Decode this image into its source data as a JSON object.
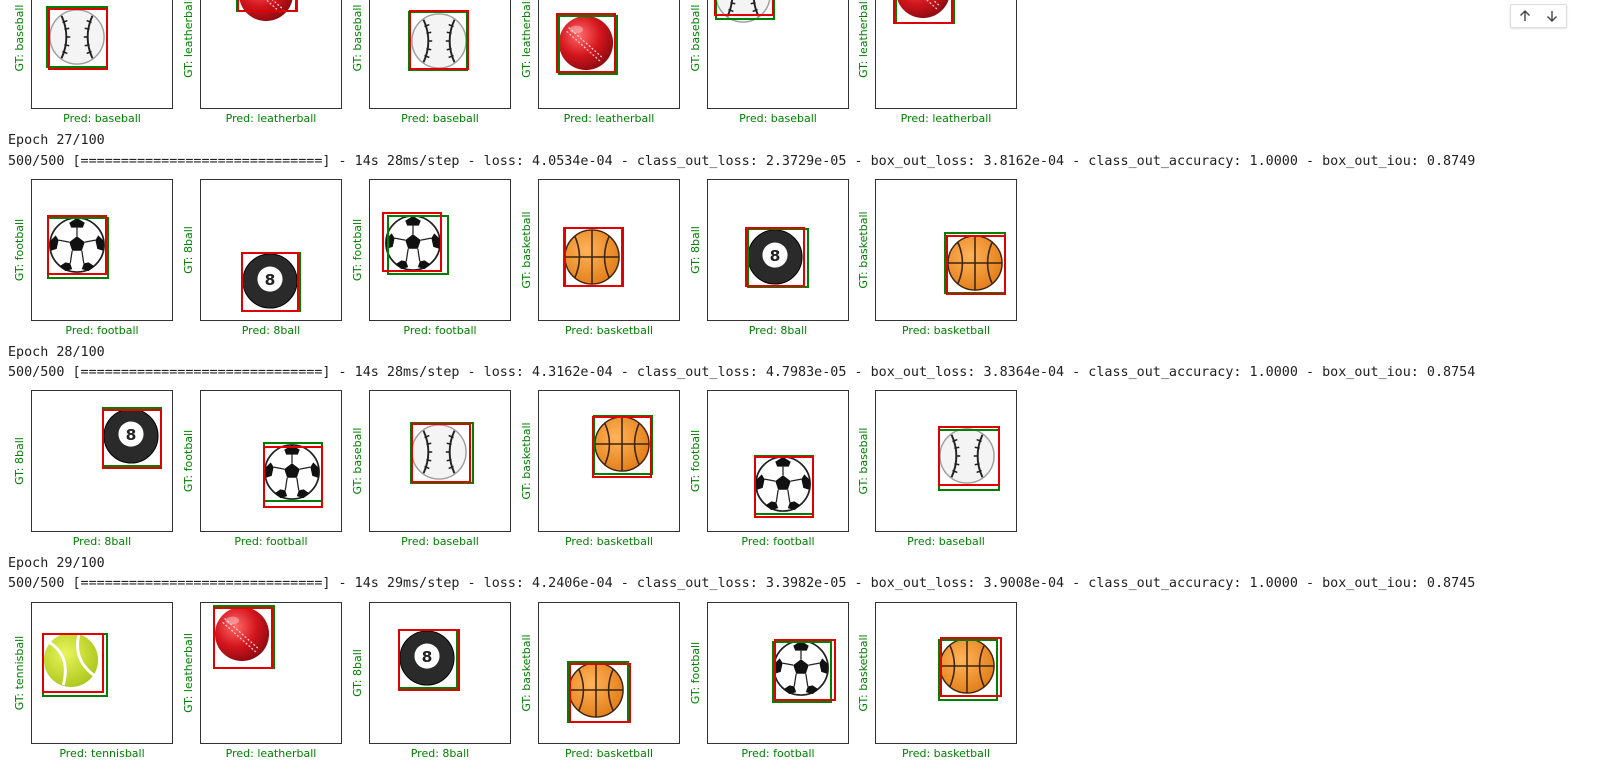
{
  "nav": {
    "up_icon": "arrow-up-icon",
    "down_icon": "arrow-down-icon"
  },
  "colors": {
    "gt_label": "#008000",
    "gt_box": "#007f00",
    "pred_box": "#e00000",
    "log_text": "#212121"
  },
  "epochs": [
    {
      "epoch_line": "",
      "progress_line": "",
      "panels": [
        {
          "gt": "GT: baseball",
          "pred": "Pred: baseball",
          "ball": "baseball"
        },
        {
          "gt": "GT: leatherball",
          "pred": "Pred: leatherball",
          "ball": "leatherball"
        },
        {
          "gt": "GT: baseball",
          "pred": "Pred: baseball",
          "ball": "baseball"
        },
        {
          "gt": "GT: leatherball",
          "pred": "Pred: leatherball",
          "ball": "leatherball"
        },
        {
          "gt": "GT: baseball",
          "pred": "Pred: baseball",
          "ball": "baseball"
        },
        {
          "gt": "GT: leatherball",
          "pred": "Pred: leatherball",
          "ball": "leatherball"
        }
      ]
    },
    {
      "epoch_line": "Epoch 27/100",
      "progress_line": "500/500 [==============================] - 14s 28ms/step - loss: 4.0534e-04 - class_out_loss: 2.3729e-05 - box_out_loss: 3.8162e-04 - class_out_accuracy: 1.0000 - box_out_iou: 0.8749",
      "panels": [
        {
          "gt": "GT: football",
          "pred": "Pred: football",
          "ball": "football"
        },
        {
          "gt": "GT: 8ball",
          "pred": "Pred: 8ball",
          "ball": "8ball"
        },
        {
          "gt": "GT: football",
          "pred": "Pred: football",
          "ball": "football"
        },
        {
          "gt": "GT: basketball",
          "pred": "Pred: basketball",
          "ball": "basketball"
        },
        {
          "gt": "GT: 8ball",
          "pred": "Pred: 8ball",
          "ball": "8ball"
        },
        {
          "gt": "GT: basketball",
          "pred": "Pred: basketball",
          "ball": "basketball"
        }
      ]
    },
    {
      "epoch_line": "Epoch 28/100",
      "progress_line": "500/500 [==============================] - 14s 28ms/step - loss: 4.3162e-04 - class_out_loss: 4.7983e-05 - box_out_loss: 3.8364e-04 - class_out_accuracy: 1.0000 - box_out_iou: 0.8754",
      "panels": [
        {
          "gt": "GT: 8ball",
          "pred": "Pred: 8ball",
          "ball": "8ball"
        },
        {
          "gt": "GT: football",
          "pred": "Pred: football",
          "ball": "football"
        },
        {
          "gt": "GT: baseball",
          "pred": "Pred: baseball",
          "ball": "baseball"
        },
        {
          "gt": "GT: basketball",
          "pred": "Pred: basketball",
          "ball": "basketball"
        },
        {
          "gt": "GT: football",
          "pred": "Pred: football",
          "ball": "football"
        },
        {
          "gt": "GT: baseball",
          "pred": "Pred: baseball",
          "ball": "baseball"
        }
      ]
    },
    {
      "epoch_line": "Epoch 29/100",
      "progress_line": "500/500 [==============================] - 14s 29ms/step - loss: 4.2406e-04 - class_out_loss: 3.3982e-05 - box_out_loss: 3.9008e-04 - class_out_accuracy: 1.0000 - box_out_iou: 0.8745",
      "panels": [
        {
          "gt": "GT: tennisball",
          "pred": "Pred: tennisball",
          "ball": "tennisball"
        },
        {
          "gt": "GT: leatherball",
          "pred": "Pred: leatherball",
          "ball": "leatherball"
        },
        {
          "gt": "GT: 8ball",
          "pred": "Pred: 8ball",
          "ball": "8ball"
        },
        {
          "gt": "GT: basketball",
          "pred": "Pred: basketball",
          "ball": "basketball"
        },
        {
          "gt": "GT: football",
          "pred": "Pred: football",
          "ball": "football"
        },
        {
          "gt": "GT: basketball",
          "pred": "Pred: basketball",
          "ball": "basketball"
        }
      ]
    }
  ]
}
